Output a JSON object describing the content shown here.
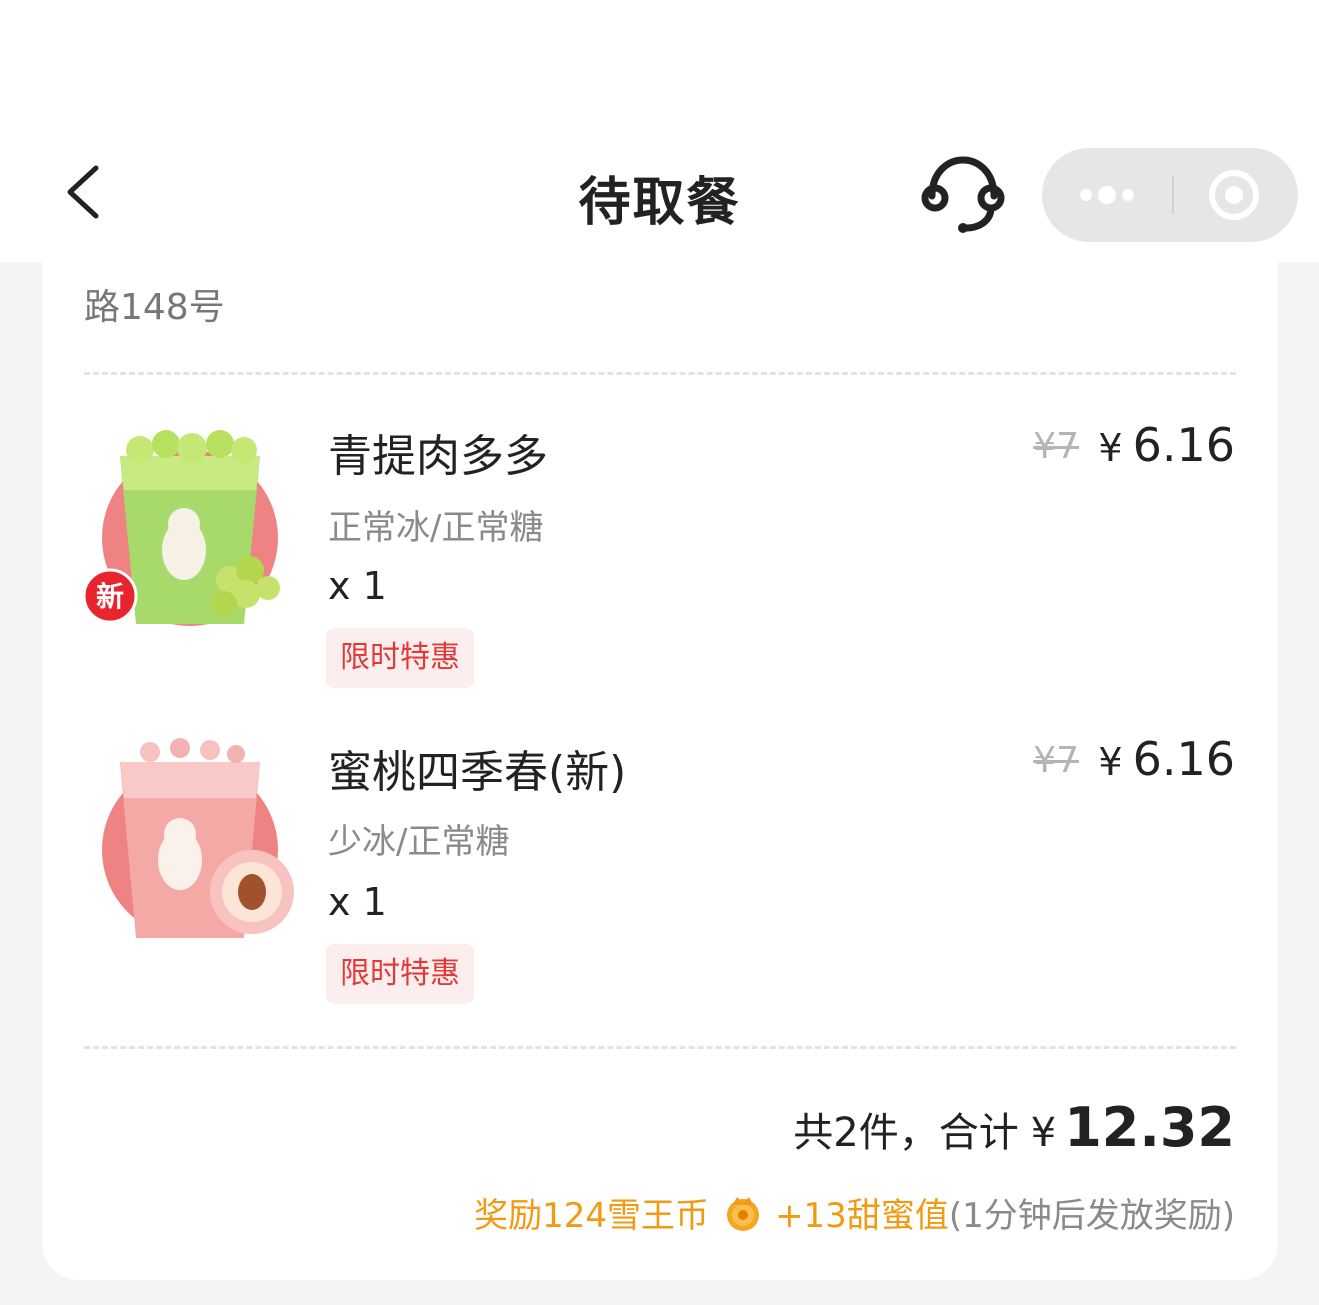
{
  "header": {
    "title": "待取餐",
    "back_icon": "chevron-left-icon",
    "support_icon": "customer-service-headset-icon",
    "capsule": {
      "more_icon": "more-dots-icon",
      "close_icon": "target-circle-icon"
    }
  },
  "store": {
    "address_tail": "路148号"
  },
  "items": [
    {
      "name": "青提肉多多",
      "spec": "正常冰/正常糖",
      "qty": "x 1",
      "promo": "限时特惠",
      "original_price": "¥7",
      "currency": "¥",
      "price": "6.16",
      "badge": "新",
      "image": "green-grape-drink-image"
    },
    {
      "name": "蜜桃四季春(新)",
      "spec": "少冰/正常糖",
      "qty": "x 1",
      "promo": "限时特惠",
      "original_price": "¥7",
      "currency": "¥",
      "price": "6.16",
      "image": "peach-tea-drink-image"
    }
  ],
  "summary": {
    "count_label": "共2件，合计",
    "currency": "¥",
    "total": "12.32"
  },
  "reward": {
    "coins_text": "奖励124雪王币",
    "coin_icon": "crown-coin-icon",
    "sweet_text": "+13甜蜜值",
    "note": "(1分钟后发放奖励)"
  },
  "colors": {
    "promo_bg": "#fdeeee",
    "promo_text": "#e23a3a",
    "reward_orange": "#f29b12",
    "badge_red": "#e8242f"
  }
}
